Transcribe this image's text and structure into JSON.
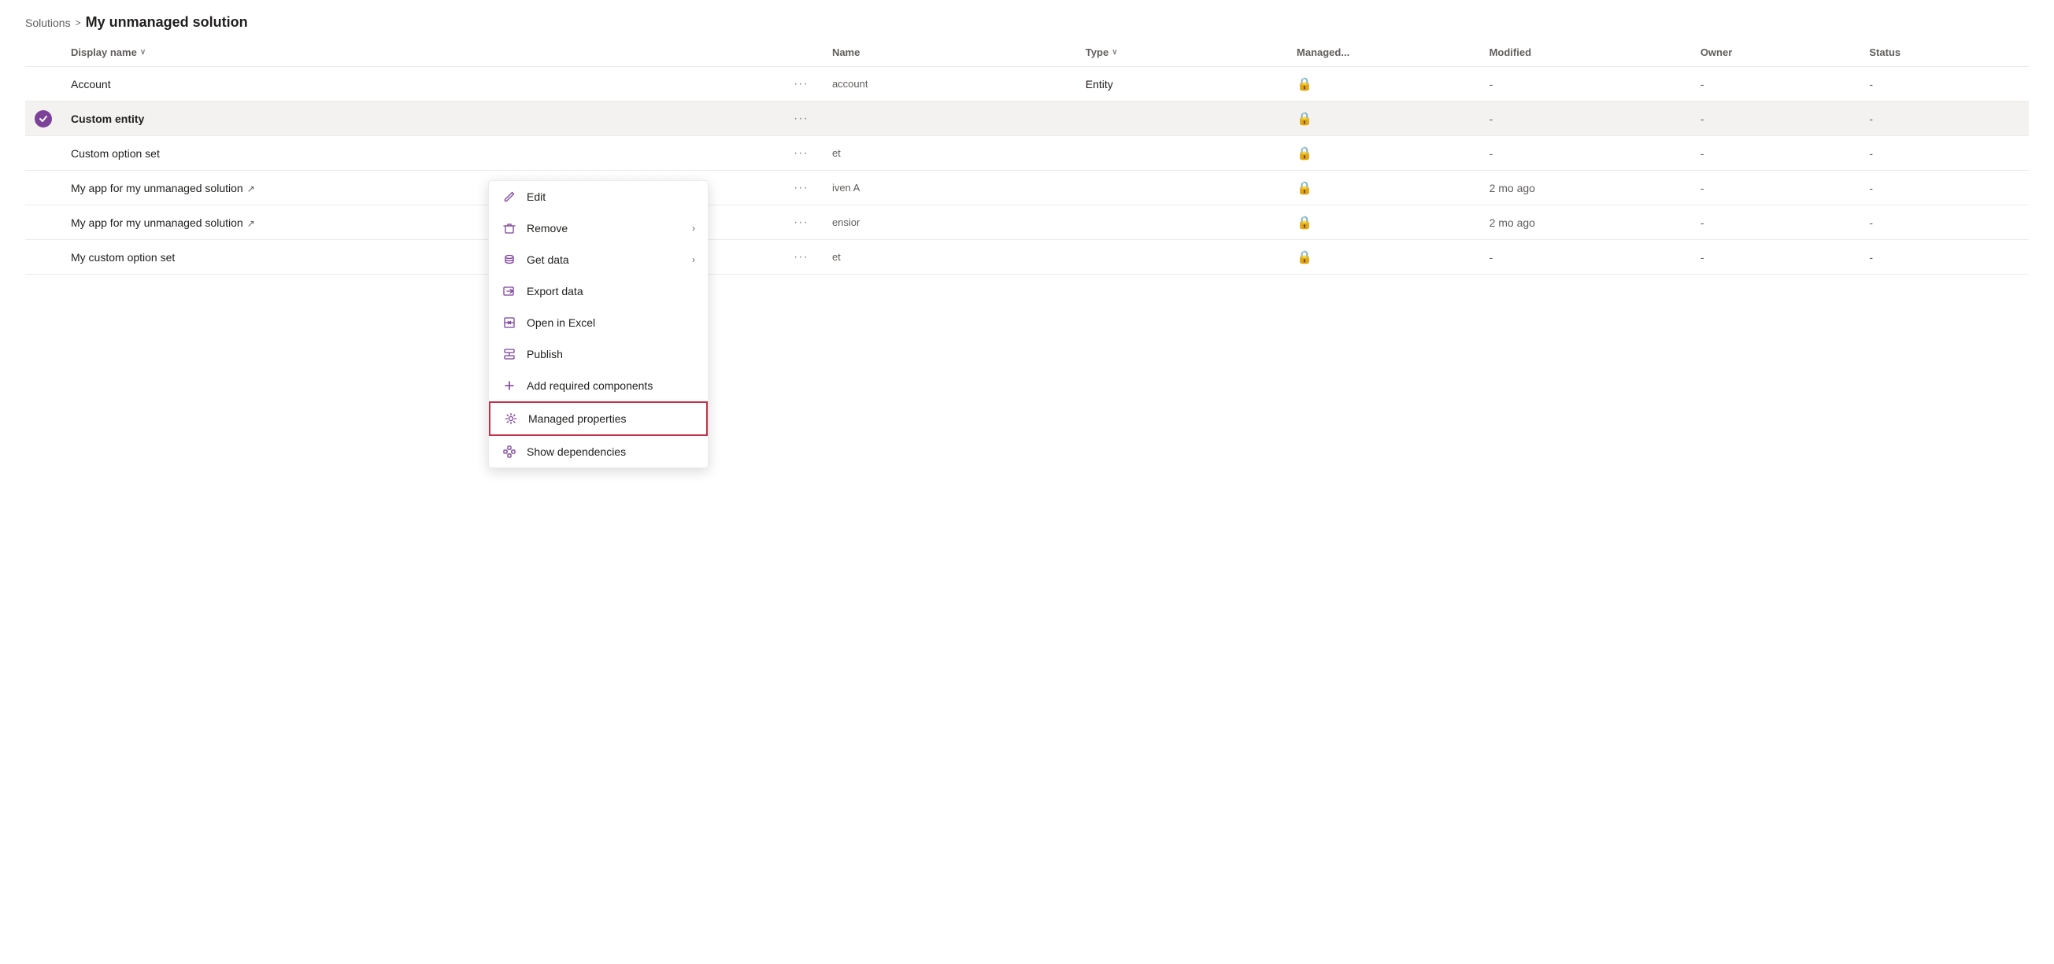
{
  "breadcrumb": {
    "solutions_label": "Solutions",
    "separator": ">",
    "current_page": "My unmanaged solution"
  },
  "table": {
    "columns": [
      {
        "id": "check",
        "label": ""
      },
      {
        "id": "display_name",
        "label": "Display name",
        "sortable": true
      },
      {
        "id": "more",
        "label": ""
      },
      {
        "id": "name",
        "label": "Name"
      },
      {
        "id": "type",
        "label": "Type",
        "sortable": true
      },
      {
        "id": "managed",
        "label": "Managed..."
      },
      {
        "id": "modified",
        "label": "Modified"
      },
      {
        "id": "owner",
        "label": "Owner"
      },
      {
        "id": "status",
        "label": "Status"
      }
    ],
    "rows": [
      {
        "id": "account",
        "selected": false,
        "display_name": "Account",
        "external_link": false,
        "name": "account",
        "type": "Entity",
        "managed": "lock",
        "modified": "-",
        "owner": "-",
        "status": "-"
      },
      {
        "id": "custom_entity",
        "selected": true,
        "display_name": "Custom entity",
        "external_link": false,
        "name": "",
        "type": "",
        "managed": "lock",
        "modified": "-",
        "owner": "-",
        "status": "-"
      },
      {
        "id": "custom_option_set",
        "selected": false,
        "display_name": "Custom option set",
        "external_link": false,
        "name": "et",
        "type": "",
        "managed": "lock",
        "modified": "-",
        "owner": "-",
        "status": "-"
      },
      {
        "id": "my_app_1",
        "selected": false,
        "display_name": "My app for my unmanaged solution",
        "external_link": true,
        "name": "iven A",
        "type": "",
        "managed": "lock",
        "modified": "2 mo ago",
        "owner": "-",
        "status": "-"
      },
      {
        "id": "my_app_2",
        "selected": false,
        "display_name": "My app for my unmanaged solution",
        "external_link": true,
        "name": "ensior",
        "type": "",
        "managed": "lock",
        "modified": "2 mo ago",
        "owner": "-",
        "status": "-"
      },
      {
        "id": "my_custom_option_set",
        "selected": false,
        "display_name": "My custom option set",
        "external_link": false,
        "name": "et",
        "type": "",
        "managed": "lock",
        "modified": "-",
        "owner": "-",
        "status": "-"
      }
    ]
  },
  "context_menu": {
    "items": [
      {
        "id": "edit",
        "label": "Edit",
        "icon": "edit",
        "has_submenu": false
      },
      {
        "id": "remove",
        "label": "Remove",
        "icon": "trash",
        "has_submenu": true
      },
      {
        "id": "get_data",
        "label": "Get data",
        "icon": "database",
        "has_submenu": true
      },
      {
        "id": "export_data",
        "label": "Export data",
        "icon": "export",
        "has_submenu": false
      },
      {
        "id": "open_excel",
        "label": "Open in Excel",
        "icon": "excel",
        "has_submenu": false
      },
      {
        "id": "publish",
        "label": "Publish",
        "icon": "publish",
        "has_submenu": false
      },
      {
        "id": "add_required",
        "label": "Add required components",
        "icon": "add",
        "has_submenu": false
      },
      {
        "id": "managed_properties",
        "label": "Managed properties",
        "icon": "gear",
        "has_submenu": false,
        "highlighted": true
      },
      {
        "id": "show_dependencies",
        "label": "Show dependencies",
        "icon": "dependencies",
        "has_submenu": false
      }
    ]
  }
}
